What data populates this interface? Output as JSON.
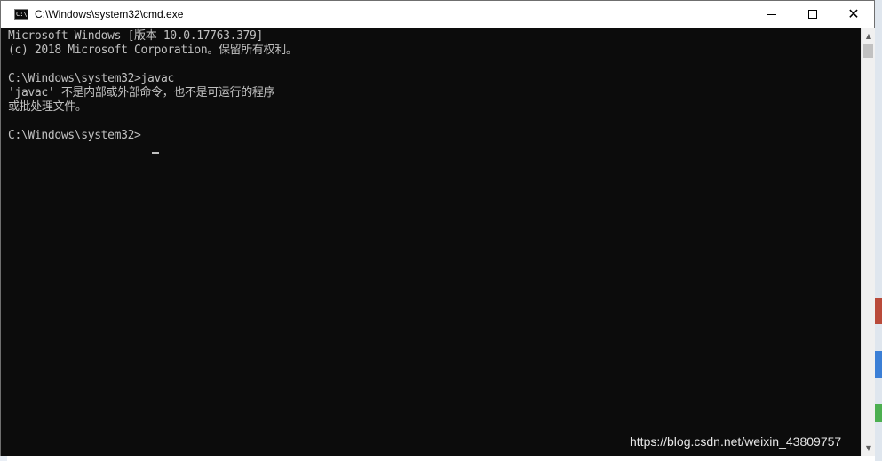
{
  "window": {
    "title": "C:\\Windows\\system32\\cmd.exe",
    "icon": "cmd-icon",
    "icon_text": "C:\\",
    "controls": [
      "minimize-icon",
      "maximize-icon",
      "close-icon"
    ]
  },
  "console": {
    "background": "#0c0c0c",
    "foreground": "#c0c0c0",
    "lines": [
      "Microsoft Windows [版本 10.0.17763.379]",
      "(c) 2018 Microsoft Corporation。保留所有权利。",
      "",
      "C:\\Windows\\system32>javac",
      "'javac' 不是内部或外部命令，也不是可运行的程序",
      "或批处理文件。",
      "",
      "C:\\Windows\\system32>"
    ]
  },
  "watermark": "https://blog.csdn.net/weixin_43809757"
}
